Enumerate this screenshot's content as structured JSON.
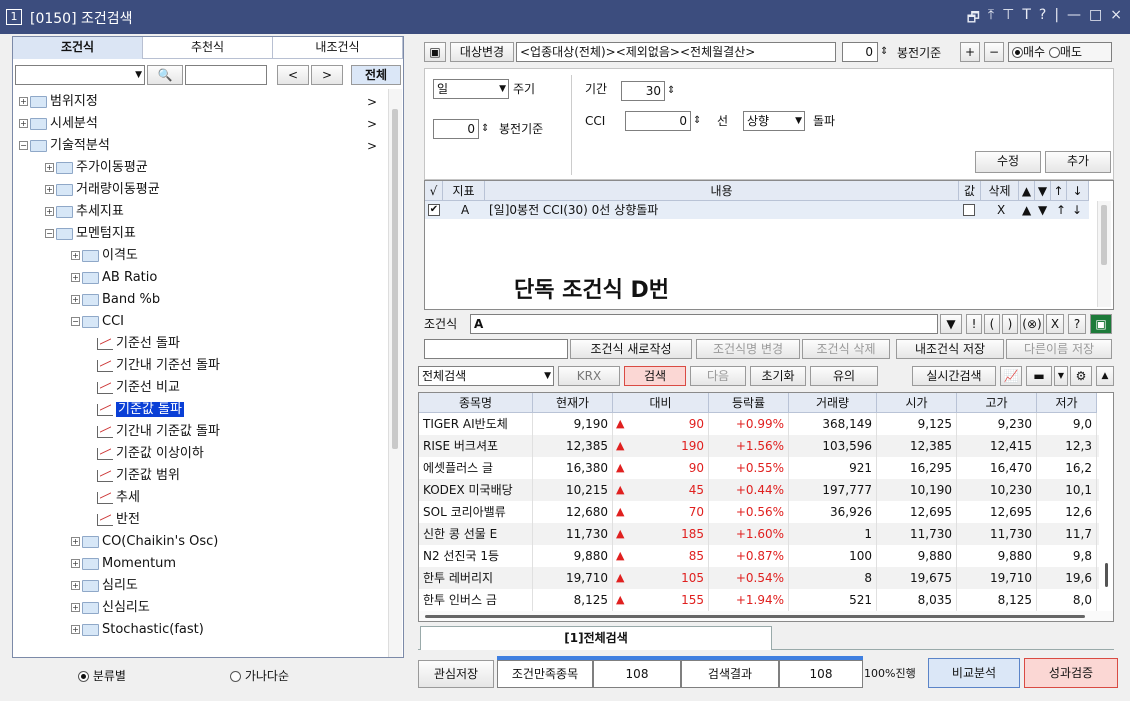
{
  "window": {
    "num": "1",
    "title": "[0150] 조건검색",
    "controls": [
      "🗗",
      "⤒",
      "⊤",
      "T",
      "?",
      "|",
      "—",
      "□",
      "×"
    ]
  },
  "left": {
    "tabs": [
      "조건식",
      "추천식",
      "내조건식"
    ],
    "search_btn": "🔍",
    "prev": "<",
    "next": ">",
    "all_btn": "전체",
    "tree": [
      {
        "label": "범위지정",
        "lvl": 0,
        "pm": "+",
        "arrow": ">"
      },
      {
        "label": "시세분석",
        "lvl": 0,
        "pm": "+",
        "arrow": ">"
      },
      {
        "label": "기술적분석",
        "lvl": 0,
        "pm": "−",
        "arrow": ">"
      },
      {
        "label": "주가이동평균",
        "lvl": 1,
        "pm": "+"
      },
      {
        "label": "거래량이동평균",
        "lvl": 1,
        "pm": "+"
      },
      {
        "label": "추세지표",
        "lvl": 1,
        "pm": "+"
      },
      {
        "label": "모멘텀지표",
        "lvl": 1,
        "pm": "−"
      },
      {
        "label": "이격도",
        "lvl": 2,
        "pm": "+"
      },
      {
        "label": "AB Ratio",
        "lvl": 2,
        "pm": "+"
      },
      {
        "label": "Band %b",
        "lvl": 2,
        "pm": "+"
      },
      {
        "label": "CCI",
        "lvl": 2,
        "pm": "−"
      },
      {
        "label": "기준선 돌파",
        "lvl": 3,
        "leaf": true
      },
      {
        "label": "기간내 기준선 돌파",
        "lvl": 3,
        "leaf": true
      },
      {
        "label": "기준선 비교",
        "lvl": 3,
        "leaf": true
      },
      {
        "label": "기준값 돌파",
        "lvl": 3,
        "leaf": true,
        "selected": true
      },
      {
        "label": "기간내 기준값 돌파",
        "lvl": 3,
        "leaf": true
      },
      {
        "label": "기준값 이상이하",
        "lvl": 3,
        "leaf": true
      },
      {
        "label": "기준값 범위",
        "lvl": 3,
        "leaf": true
      },
      {
        "label": "추세",
        "lvl": 3,
        "leaf": true
      },
      {
        "label": "반전",
        "lvl": 3,
        "leaf": true
      },
      {
        "label": "CO(Chaikin's Osc)",
        "lvl": 2,
        "pm": "+"
      },
      {
        "label": "Momentum",
        "lvl": 2,
        "pm": "+"
      },
      {
        "label": "심리도",
        "lvl": 2,
        "pm": "+"
      },
      {
        "label": "신심리도",
        "lvl": 2,
        "pm": "+"
      },
      {
        "label": "Stochastic(fast)",
        "lvl": 2,
        "pm": "+"
      }
    ],
    "radio1": "분류별",
    "radio2": "가나다순"
  },
  "top": {
    "target_btn": "대상변경",
    "target_text": "<업종대상(전체)><제외없음><전체월결산>",
    "bong_val": "0",
    "bong_label": "봉전기준",
    "plus": "+",
    "minus": "−",
    "buy": "매수",
    "sell": "매도"
  },
  "cond": {
    "period_sel": "일",
    "period_lbl": "주기",
    "bong_val": "0",
    "bong_lbl": "봉전기준",
    "term_lbl": "기간",
    "term_val": "30",
    "cci_lbl": "CCI",
    "cci_val": "0",
    "line_lbl": "선",
    "dir_sel": "상향",
    "cross_lbl": "돌파",
    "edit_btn": "수정",
    "add_btn": "추가"
  },
  "condtable": {
    "headers": [
      "√",
      "지표",
      "내용",
      "값",
      "삭제",
      "▲",
      "▼",
      "↑",
      "↓"
    ],
    "row": {
      "ind": "A",
      "content": "[일]0봉전 CCI(30) 0선 상향돌파",
      "del": "X",
      "up": "▲",
      "down": "▼",
      "top": "↑",
      "bottom": "↓"
    }
  },
  "overlay": "단독 조건식 D번",
  "formula": {
    "label": "조건식",
    "value": "A",
    "btns": [
      "▼",
      "!",
      "(",
      ")",
      "(⊗)",
      "X",
      "?",
      "▣"
    ]
  },
  "actions": {
    "new": "조건식 새로작성",
    "rename": "조건식명 변경",
    "delete": "조건식 삭제",
    "save": "내조건식 저장",
    "saveas": "다른이름 저장"
  },
  "searchbar": {
    "scope": "전체검색",
    "krx": "KRX",
    "search": "검색",
    "next": "다음",
    "reset": "초기화",
    "caution": "유의",
    "realtime": "실시간검색"
  },
  "results": {
    "headers": [
      "종목명",
      "현재가",
      "대비",
      "등락률",
      "거래량",
      "시가",
      "고가",
      "저가"
    ],
    "rows": [
      [
        "TIGER AI반도체",
        "9,190",
        "90",
        "+0.99%",
        "368,149",
        "9,125",
        "9,230",
        "9,0"
      ],
      [
        "RISE 버크셔포",
        "12,385",
        "190",
        "+1.56%",
        "103,596",
        "12,385",
        "12,415",
        "12,3"
      ],
      [
        "에셋플러스 글",
        "16,380",
        "90",
        "+0.55%",
        "921",
        "16,295",
        "16,470",
        "16,2"
      ],
      [
        "KODEX 미국배당",
        "10,215",
        "45",
        "+0.44%",
        "197,777",
        "10,190",
        "10,230",
        "10,1"
      ],
      [
        "SOL 코리아밸류",
        "12,680",
        "70",
        "+0.56%",
        "36,926",
        "12,695",
        "12,695",
        "12,6"
      ],
      [
        "신한 콩 선물 E",
        "11,730",
        "185",
        "+1.60%",
        "1",
        "11,730",
        "11,730",
        "11,7"
      ],
      [
        "N2 선진국 1등",
        "9,880",
        "85",
        "+0.87%",
        "100",
        "9,880",
        "9,880",
        "9,8"
      ],
      [
        "한투 레버리지",
        "19,710",
        "105",
        "+0.54%",
        "8",
        "19,675",
        "19,710",
        "19,6"
      ],
      [
        "한투 인버스 금",
        "8,125",
        "155",
        "+1.94%",
        "521",
        "8,035",
        "8,125",
        "8,0"
      ]
    ]
  },
  "result_tab": "[1]전체검색",
  "status": {
    "fav_save": "관심저장",
    "match_lbl": "조건만족종목",
    "match_val": "108",
    "result_lbl": "검색결과",
    "result_val": "108",
    "progress": 1.0,
    "progress_lbl": "100%진행",
    "compare": "비교분석",
    "perf": "성과검증"
  }
}
